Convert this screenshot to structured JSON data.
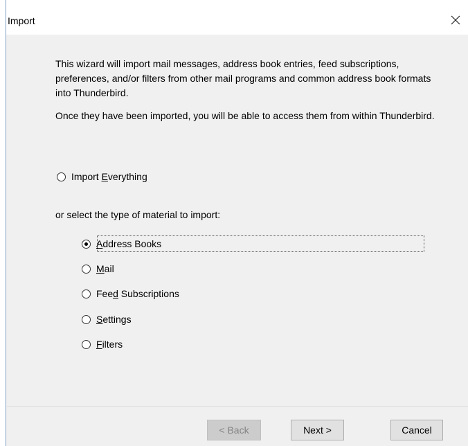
{
  "window": {
    "title": "Import",
    "close_glyph": "close-icon"
  },
  "intro": {
    "paragraph1": "This wizard will import mail messages, address book entries, feed subscriptions, preferences, and/or filters from other mail programs and common address book formats into Thunderbird.",
    "paragraph2": "Once they have been imported, you will be able to access them from within Thunderbird."
  },
  "import_everything": {
    "label_pre": "Import ",
    "label_accel": "E",
    "label_post": "verything",
    "checked": false
  },
  "select_prompt": "or select the type of material to import:",
  "options": [
    {
      "pre": "",
      "accel": "A",
      "post": "ddress Books",
      "checked": true
    },
    {
      "pre": "",
      "accel": "M",
      "post": "ail",
      "checked": false
    },
    {
      "pre": "Fee",
      "accel": "d",
      "post": " Subscriptions",
      "checked": false
    },
    {
      "pre": "",
      "accel": "S",
      "post": "ettings",
      "checked": false
    },
    {
      "pre": "",
      "accel": "F",
      "post": "ilters",
      "checked": false
    }
  ],
  "buttons": {
    "back": "< Back",
    "next": "Next >",
    "cancel": "Cancel"
  },
  "colors": {
    "window_bg": "#f0f0f0",
    "title_bg": "#ffffff",
    "border_accent": "#7a9cc6",
    "button_bg": "#e1e1e1",
    "button_disabled_text": "#838383"
  }
}
